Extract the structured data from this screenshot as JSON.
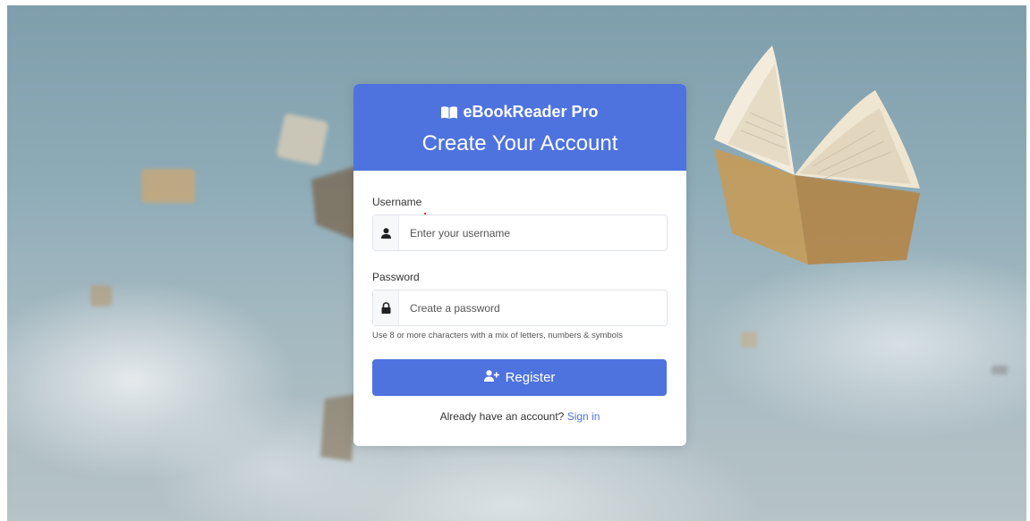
{
  "brand": {
    "name": "eBookReader Pro",
    "icon": "open-book-icon"
  },
  "header": {
    "title": "Create Your Account"
  },
  "form": {
    "username": {
      "label": "Username",
      "placeholder": "Enter your username",
      "value": "",
      "icon": "user-icon"
    },
    "password": {
      "label": "Password",
      "placeholder": "Create a password",
      "value": "",
      "icon": "lock-icon",
      "hint": "Use 8 or more characters with a mix of letters, numbers & symbols"
    },
    "submit": {
      "label": "Register",
      "icon": "user-plus-icon"
    }
  },
  "footer": {
    "prompt": "Already have an account?",
    "link_label": "Sign in"
  },
  "colors": {
    "primary": "#4e73df",
    "card_bg": "#ffffff"
  }
}
